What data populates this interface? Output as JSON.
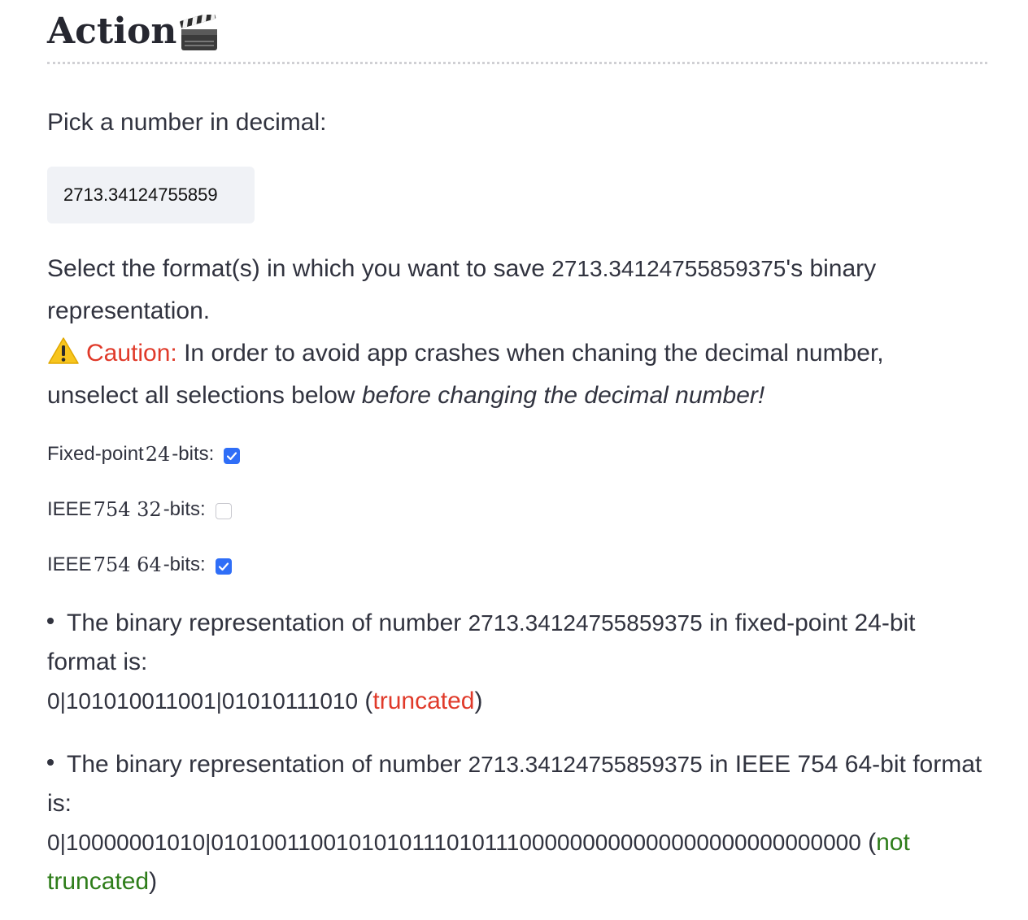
{
  "section": {
    "title": "Action",
    "title_icon": "clapper-board-icon"
  },
  "decimal_input": {
    "label": "Pick a number in decimal:",
    "value": "2713.34124755859375",
    "display_value": "2713.34124755859"
  },
  "instructions": {
    "prefix": "Select the format(s) in which you want to save ",
    "number": "2713.34124755859375",
    "suffix_line1": "'s binary",
    "suffix_line2": "representation.",
    "caution_icon": "warning-icon",
    "caution_label": "Caution:",
    "caution_text_line1": " In order to avoid app crashes when chaning the decimal number,",
    "caution_text_line2": "unselect all selections below ",
    "caution_emphasis": "before changing the decimal number!"
  },
  "formats": [
    {
      "label_pre": "Fixed-point ",
      "num": "24",
      "label_post": "-bits:",
      "checked": true
    },
    {
      "label_pre": "IEEE ",
      "num": "754 32",
      "label_post": "-bits:",
      "checked": false
    },
    {
      "label_pre": "IEEE ",
      "num": "754 64",
      "label_post": "-bits:",
      "checked": true
    }
  ],
  "results": [
    {
      "line1_pre": "The binary representation of number ",
      "number": "2713.34124755859375",
      "line1_post": " in fixed-point 24-bit",
      "line2": "format is:",
      "binary": "0|101010011001|0101011101O",
      "binary_text": "0|101010011001|0101011101O",
      "status_open": " (",
      "status": "truncated",
      "status_close": ")"
    },
    {
      "line1_pre": "The binary representation of number ",
      "number": "2713.34124755859375",
      "line1_post": " in IEEE 754 64-bit format",
      "line2": "is:",
      "binary": "0|10000001010|0101001100101010111010111000000000000000000000000000",
      "status_open": " (",
      "status_line1": "not",
      "status_line2": "truncated",
      "status_close": ")"
    }
  ],
  "colors": {
    "text": "#31333f",
    "caution": "#e03a2a",
    "truncated": "#e03a2a",
    "not_truncated": "#2e7d1a",
    "checkbox_checked": "#2f6ef7",
    "input_bg": "#f0f2f6"
  }
}
